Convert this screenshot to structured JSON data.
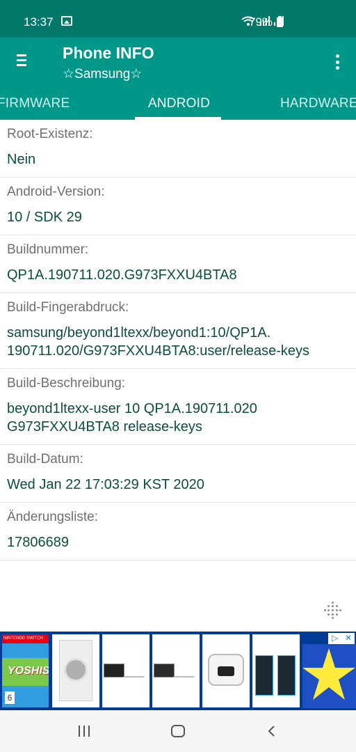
{
  "status": {
    "time": "13:37",
    "battery": "79%"
  },
  "app": {
    "title": "Phone INFO",
    "subtitle": "☆Samsung☆"
  },
  "tabs": [
    {
      "label": "FIRMWARE"
    },
    {
      "label": "ANDROID"
    },
    {
      "label": "HARDWARE"
    }
  ],
  "info": [
    {
      "label": "Root-Existenz:",
      "value": "Nein"
    },
    {
      "label": "Android-Version:",
      "value": "10 / SDK 29"
    },
    {
      "label": "Buildnummer:",
      "value": "QP1A.190711.020.G973FXXU4BTA8"
    },
    {
      "label": "Build-Fingerabdruck:",
      "value_line1": "samsung/beyond1ltexx/beyond1:10/QP1A.",
      "value_line2": "190711.020/G973FXXU4BTA8:user/release-keys"
    },
    {
      "label": "Build-Beschreibung:",
      "value_line1": "beyond1ltexx-user 10 QP1A.190711.020",
      "value_line2": "G973FXXU4BTA8 release-keys"
    },
    {
      "label": "Build-Datum:",
      "value": "Wed Jan 22 17:03:29 KST 2020"
    },
    {
      "label": "Änderungsliste:",
      "value": "17806689"
    }
  ],
  "ad": {
    "product_text": "YOSHIS",
    "platform_text": "NINTENDO SWITCH",
    "rating": "6"
  },
  "colors": {
    "primary": "#009688",
    "primary_dark": "#00796b",
    "value_text": "#0d4d3f",
    "ad_background": "#003b95"
  }
}
